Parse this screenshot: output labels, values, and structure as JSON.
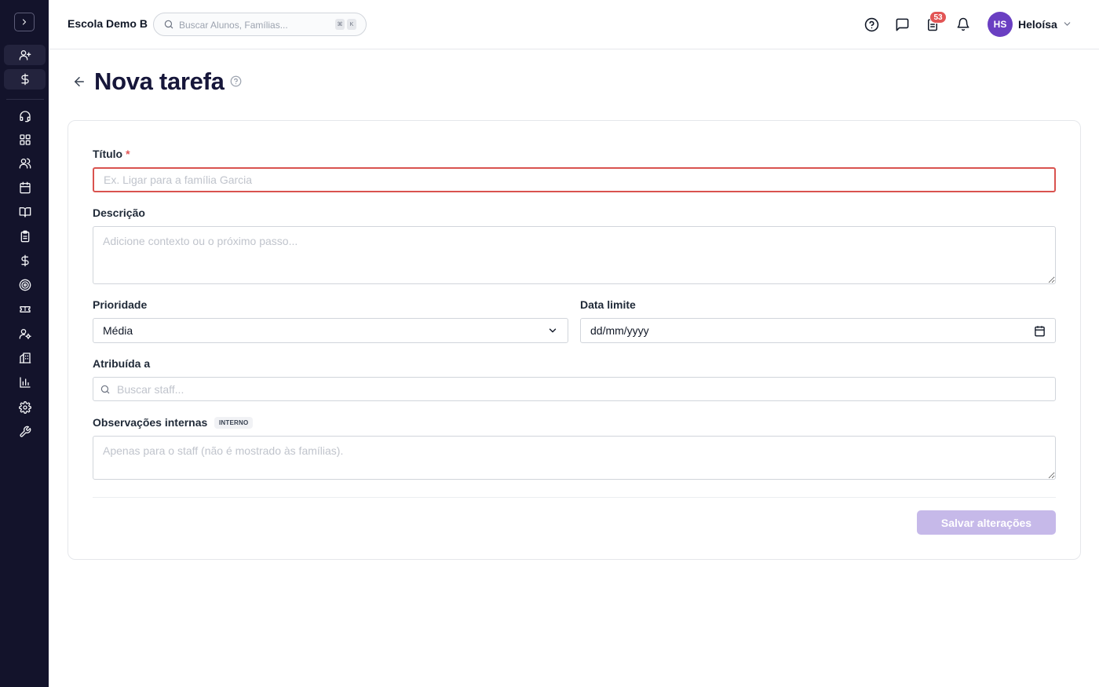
{
  "header": {
    "school_name": "Escola Demo B",
    "search_placeholder": "Buscar Alunos, Famílias...",
    "kbd_keys": [
      "⌘",
      "K"
    ],
    "tasks_badge": "53",
    "user": {
      "initials": "HS",
      "name": "Heloísa"
    }
  },
  "sidebar": {
    "items": [
      "user-plus-icon",
      "dollar-icon",
      "headset-icon",
      "dashboard-icon",
      "users-icon",
      "calendar-icon",
      "book-icon",
      "clipboard-icon",
      "dollar-icon",
      "target-icon",
      "ticket-icon",
      "user-cog-icon",
      "building-icon",
      "bar-chart-icon",
      "settings-icon",
      "wrench-icon"
    ]
  },
  "page": {
    "title": "Nova tarefa"
  },
  "form": {
    "title_label": "Título",
    "title_required": "*",
    "title_placeholder": "Ex. Ligar para a família Garcia",
    "description_label": "Descrição",
    "description_placeholder": "Adicione contexto ou o próximo passo...",
    "priority_label": "Prioridade",
    "priority_value": "Média",
    "deadline_label": "Data limite",
    "deadline_value": "dd/mm/yyyy",
    "assigned_label": "Atribuída a",
    "assigned_placeholder": "Buscar staff...",
    "notes_label": "Observações internas",
    "notes_tag": "INTERNO",
    "notes_placeholder": "Apenas para o staff (não é mostrado às famílias).",
    "save_label": "Salvar alterações"
  },
  "colors": {
    "sidebar_bg": "#13132b",
    "accent": "#6a3fc2",
    "error": "#d9534f",
    "badge": "#e25555",
    "save_disabled": "#c6b9e9"
  }
}
